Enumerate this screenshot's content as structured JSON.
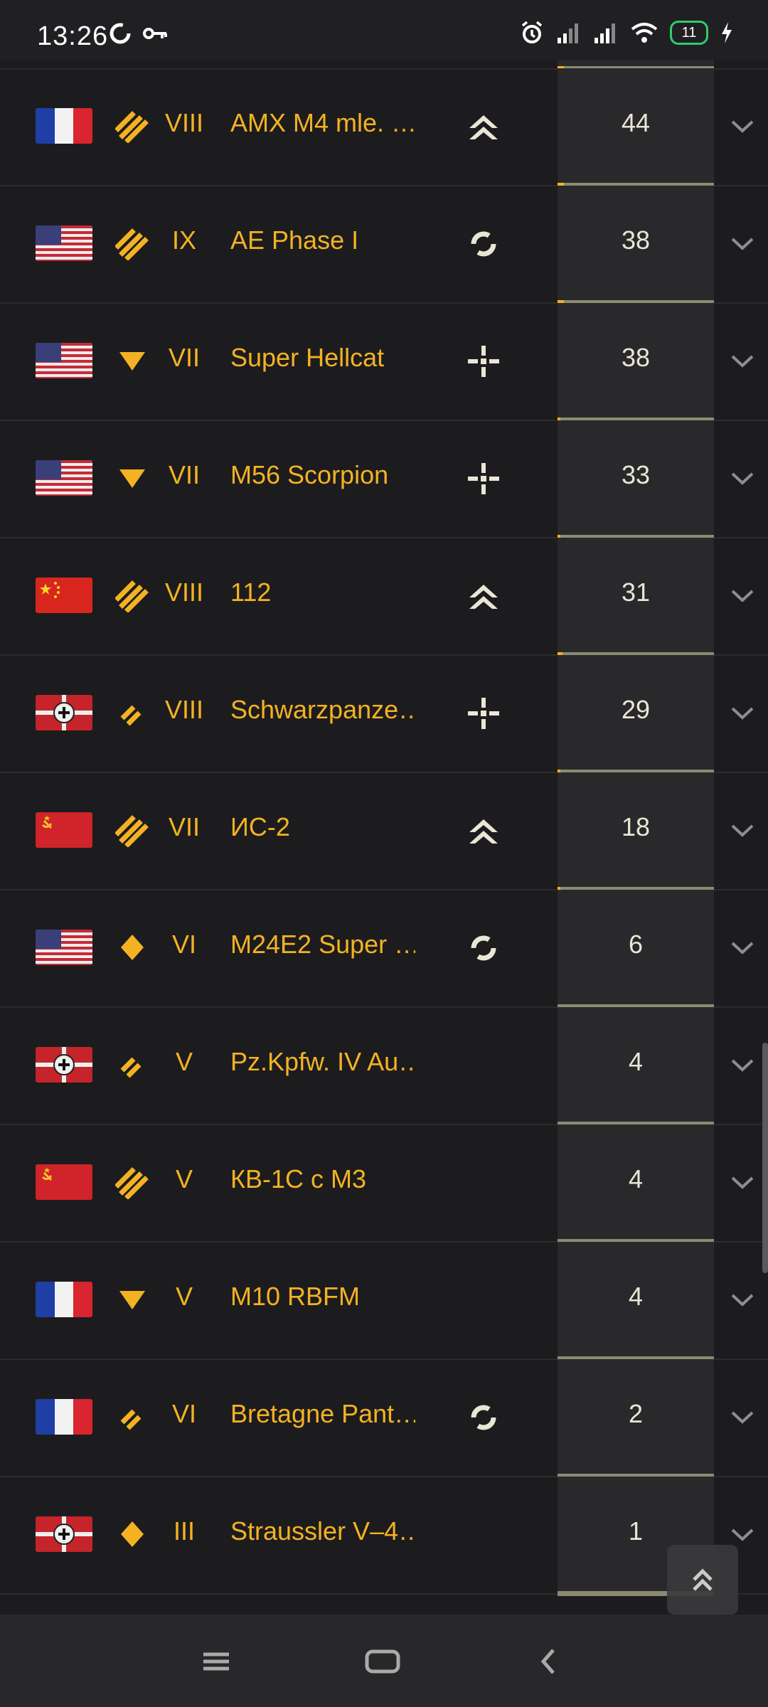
{
  "status_bar": {
    "time": "13:26",
    "battery": "11"
  },
  "rows": [
    {
      "flag": "france",
      "type": "med",
      "tier": "VIII",
      "name": "AMX M4 mle. …",
      "role": "chevrons",
      "count": "44",
      "progress": 0.04
    },
    {
      "flag": "usa",
      "type": "med",
      "tier": "IX",
      "name": "AE Phase I",
      "role": "rotate",
      "count": "38",
      "progress": 0.04
    },
    {
      "flag": "usa",
      "type": "td",
      "tier": "VII",
      "name": "Super Hellcat",
      "role": "cross",
      "count": "38",
      "progress": 0.02
    },
    {
      "flag": "usa",
      "type": "td",
      "tier": "VII",
      "name": "M56 Scorpion",
      "role": "cross",
      "count": "33",
      "progress": 0.02
    },
    {
      "flag": "china",
      "type": "med",
      "tier": "VIII",
      "name": "112",
      "role": "chevrons",
      "count": "31",
      "progress": 0.03
    },
    {
      "flag": "germany",
      "type": "light",
      "tier": "VIII",
      "name": "Schwarzpanze…",
      "role": "cross",
      "count": "29",
      "progress": 0.02
    },
    {
      "flag": "ussr",
      "type": "med",
      "tier": "VII",
      "name": "ИС-2",
      "role": "chevrons",
      "count": "18",
      "progress": 0.02
    },
    {
      "flag": "usa",
      "type": "lt",
      "tier": "VI",
      "name": "M24E2 Super …",
      "role": "rotate",
      "count": "6",
      "progress": 0
    },
    {
      "flag": "germany",
      "type": "light",
      "tier": "V",
      "name": "Pz.Kpfw. IV Au…",
      "role": "",
      "count": "4",
      "progress": 0
    },
    {
      "flag": "ussr",
      "type": "med",
      "tier": "V",
      "name": "КВ-1С с М3",
      "role": "",
      "count": "4",
      "progress": 0
    },
    {
      "flag": "france",
      "type": "td",
      "tier": "V",
      "name": "M10 RBFM",
      "role": "",
      "count": "4",
      "progress": 0
    },
    {
      "flag": "france",
      "type": "light",
      "tier": "VI",
      "name": "Bretagne Pant…",
      "role": "rotate",
      "count": "2",
      "progress": 0
    },
    {
      "flag": "germany",
      "type": "lt",
      "tier": "III",
      "name": "Straussler V–4…",
      "role": "",
      "count": "1",
      "progress": 0
    }
  ],
  "colors": {
    "accent": "#f4b223",
    "count_text": "#e9e6d6",
    "bar": "#8c8a74"
  }
}
